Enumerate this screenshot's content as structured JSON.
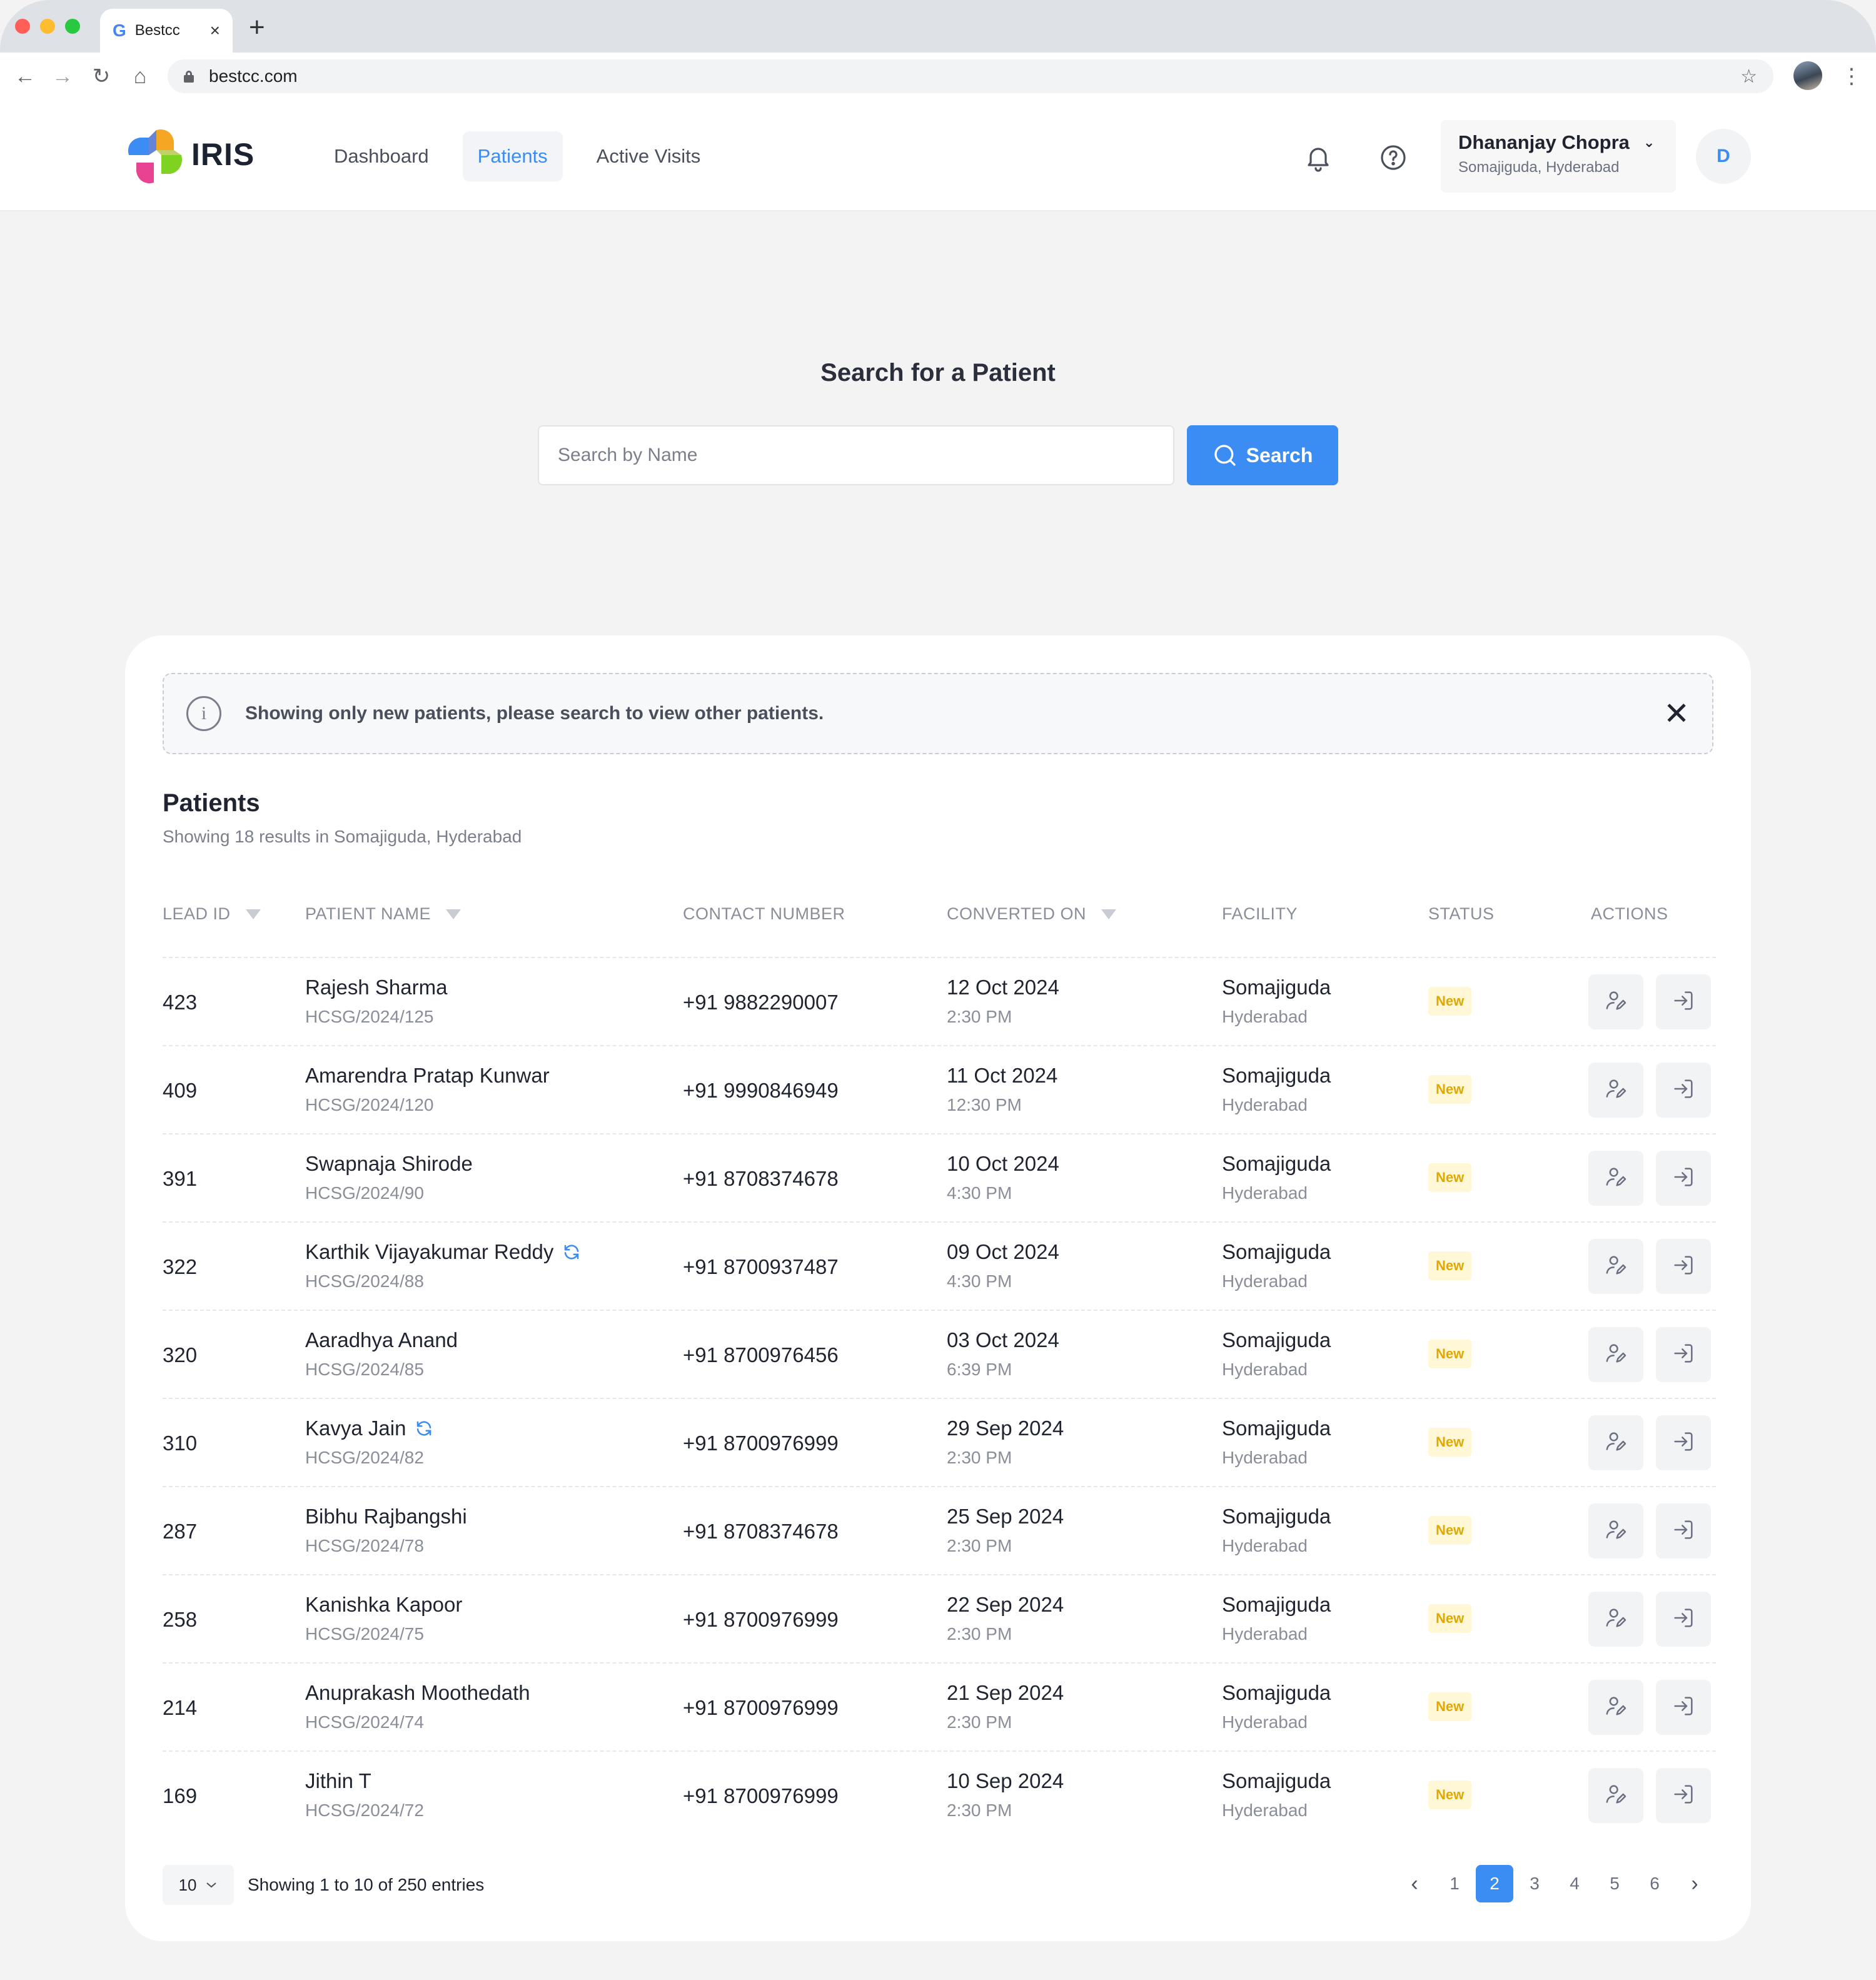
{
  "browser": {
    "tab_title": "Bestcc",
    "new_tab": "+",
    "url": "bestcc.com",
    "traffic_colors": [
      "#ff5f57",
      "#febc2e",
      "#28c840"
    ]
  },
  "app": {
    "logo_text": "IRIS",
    "nav": [
      {
        "label": "Dashboard",
        "active": false
      },
      {
        "label": "Patients",
        "active": true
      },
      {
        "label": "Active Visits",
        "active": false
      }
    ],
    "user": {
      "name": "Dhananjay Chopra",
      "location": "Somajiguda, Hyderabad",
      "avatar_initial": "D"
    },
    "accent_color": "#3b8cf3"
  },
  "search": {
    "title": "Search for a Patient",
    "placeholder": "Search by Name",
    "button_label": "Search"
  },
  "notice": {
    "message": "Showing only new patients, please search to view other patients.",
    "close_glyph": "✕"
  },
  "patients": {
    "title": "Patients",
    "subtitle": "Showing 18 results in Somajiguda, Hyderabad",
    "columns": {
      "lead_id": "LEAD ID",
      "patient_name": "PATIENT NAME",
      "contact": "CONTACT NUMBER",
      "converted_on": "CONVERTED ON",
      "facility": "FACILITY",
      "status": "STATUS",
      "actions": "ACTIONS"
    },
    "rows": [
      {
        "lead_id": "423",
        "name": "Rajesh Sharma",
        "code": "HCSG/2024/125",
        "phone": "+91 9882290007",
        "date": "12 Oct 2024",
        "time": "2:30 PM",
        "facility": "Somajiguda",
        "city": "Hyderabad",
        "status": "New",
        "sync": false
      },
      {
        "lead_id": "409",
        "name": "Amarendra Pratap Kunwar",
        "code": "HCSG/2024/120",
        "phone": "+91 9990846949",
        "date": "11 Oct 2024",
        "time": "12:30 PM",
        "facility": "Somajiguda",
        "city": "Hyderabad",
        "status": "New",
        "sync": false
      },
      {
        "lead_id": "391",
        "name": "Swapnaja Shirode",
        "code": "HCSG/2024/90",
        "phone": "+91 8708374678",
        "date": "10 Oct 2024",
        "time": "4:30 PM",
        "facility": "Somajiguda",
        "city": "Hyderabad",
        "status": "New",
        "sync": false
      },
      {
        "lead_id": "322",
        "name": "Karthik Vijayakumar Reddy",
        "code": "HCSG/2024/88",
        "phone": "+91 8700937487",
        "date": "09 Oct 2024",
        "time": "4:30 PM",
        "facility": "Somajiguda",
        "city": "Hyderabad",
        "status": "New",
        "sync": true
      },
      {
        "lead_id": "320",
        "name": "Aaradhya Anand",
        "code": "HCSG/2024/85",
        "phone": "+91 8700976456",
        "date": "03 Oct 2024",
        "time": "6:39 PM",
        "facility": "Somajiguda",
        "city": "Hyderabad",
        "status": "New",
        "sync": false
      },
      {
        "lead_id": "310",
        "name": "Kavya Jain",
        "code": "HCSG/2024/82",
        "phone": "+91 8700976999",
        "date": "29 Sep 2024",
        "time": "2:30 PM",
        "facility": "Somajiguda",
        "city": "Hyderabad",
        "status": "New",
        "sync": true
      },
      {
        "lead_id": "287",
        "name": "Bibhu Rajbangshi",
        "code": "HCSG/2024/78",
        "phone": "+91 8708374678",
        "date": "25 Sep 2024",
        "time": "2:30 PM",
        "facility": "Somajiguda",
        "city": "Hyderabad",
        "status": "New",
        "sync": false
      },
      {
        "lead_id": "258",
        "name": "Kanishka Kapoor",
        "code": "HCSG/2024/75",
        "phone": "+91 8700976999",
        "date": "22 Sep 2024",
        "time": "2:30 PM",
        "facility": "Somajiguda",
        "city": "Hyderabad",
        "status": "New",
        "sync": false
      },
      {
        "lead_id": "214",
        "name": "Anuprakash Moothedath",
        "code": "HCSG/2024/74",
        "phone": "+91 8700976999",
        "date": "21 Sep 2024",
        "time": "2:30 PM",
        "facility": "Somajiguda",
        "city": "Hyderabad",
        "status": "New",
        "sync": false
      },
      {
        "lead_id": "169",
        "name": "Jithin T",
        "code": "HCSG/2024/72",
        "phone": "+91 8700976999",
        "date": "10 Sep 2024",
        "time": "2:30 PM",
        "facility": "Somajiguda",
        "city": "Hyderabad",
        "status": "New",
        "sync": false
      }
    ],
    "page_size": "10",
    "entries_text": "Showing 1 to 10 of 250 entries",
    "pages": [
      "1",
      "2",
      "3",
      "4",
      "5",
      "6"
    ],
    "current_page": "2",
    "prev_glyph": "‹",
    "next_glyph": "›"
  }
}
